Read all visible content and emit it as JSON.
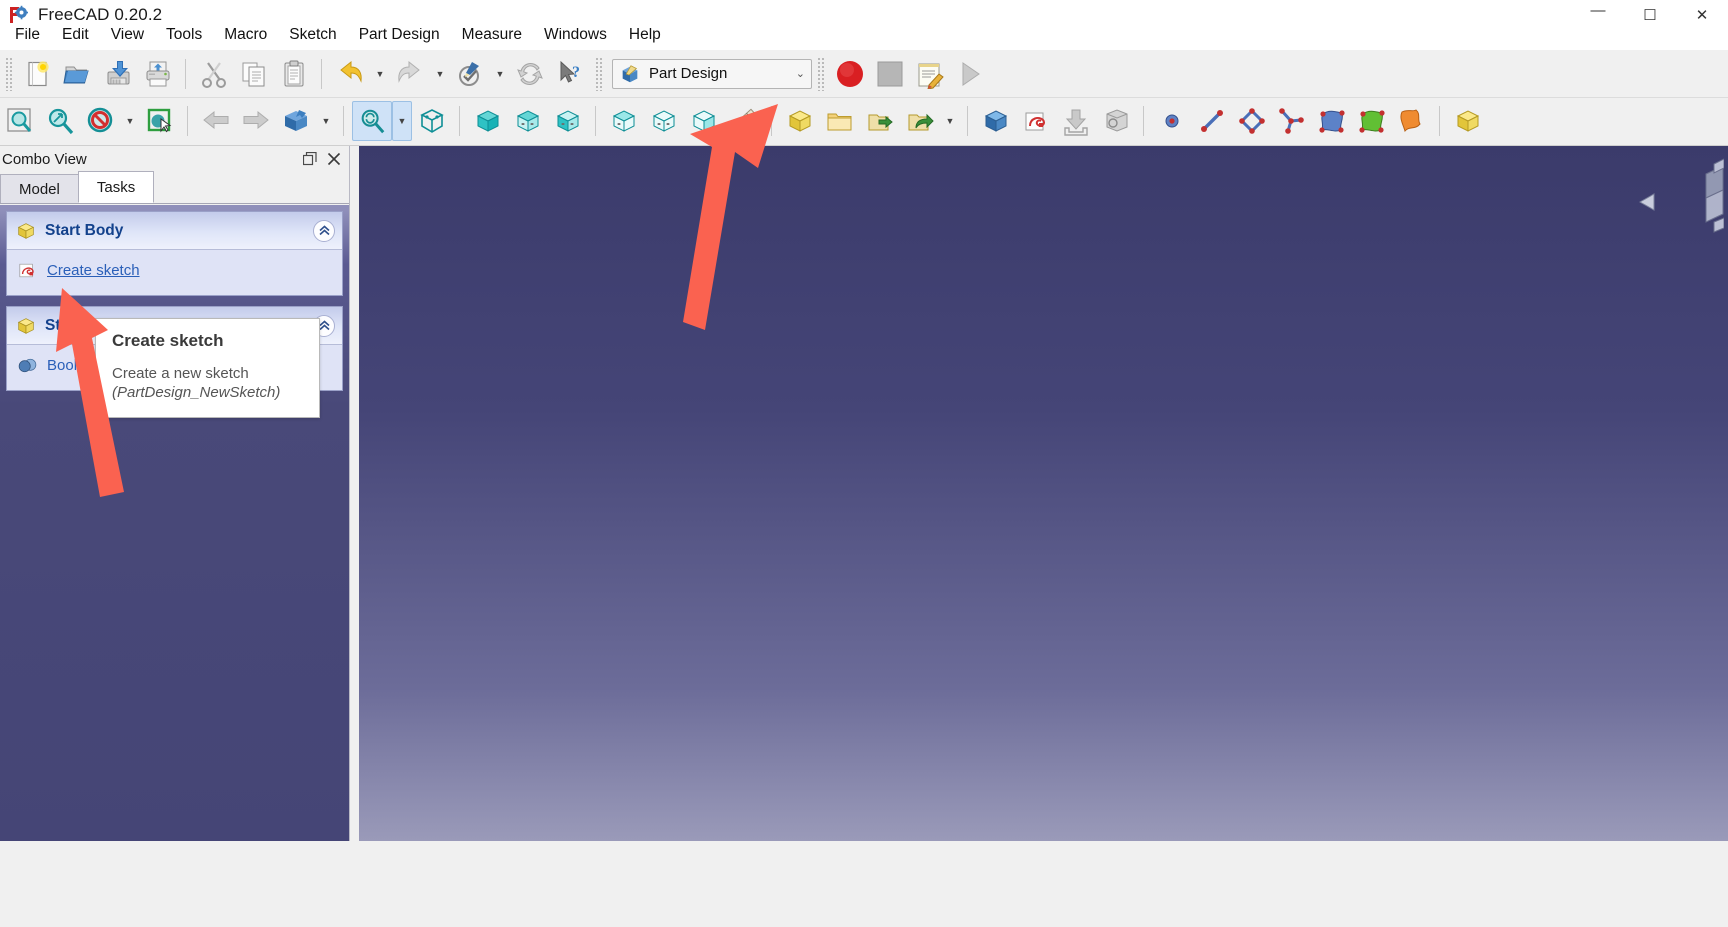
{
  "window": {
    "title": "FreeCAD 0.20.2",
    "app_icon": "freecad-logo-icon",
    "minimize_label": "—",
    "maximize_label": "☐",
    "close_label": "✕"
  },
  "menubar": {
    "items": [
      {
        "label": "File"
      },
      {
        "label": "Edit"
      },
      {
        "label": "View"
      },
      {
        "label": "Tools"
      },
      {
        "label": "Macro"
      },
      {
        "label": "Sketch"
      },
      {
        "label": "Part Design"
      },
      {
        "label": "Measure"
      },
      {
        "label": "Windows"
      },
      {
        "label": "Help"
      }
    ]
  },
  "toolbars": {
    "row1": [
      {
        "name": "new-document-button",
        "icon": "new-file-icon"
      },
      {
        "name": "open-document-button",
        "icon": "open-folder-icon"
      },
      {
        "name": "save-document-button",
        "icon": "save-disk-icon"
      },
      {
        "name": "print-button",
        "icon": "printer-icon"
      },
      {
        "name": "separator",
        "icon": "separator"
      },
      {
        "name": "cut-button",
        "icon": "scissors-icon"
      },
      {
        "name": "copy-button",
        "icon": "copy-icon"
      },
      {
        "name": "paste-button",
        "icon": "clipboard-paste-icon"
      },
      {
        "name": "separator",
        "icon": "separator"
      },
      {
        "name": "undo-button",
        "icon": "undo-arrow-icon"
      },
      {
        "name": "undo-dropdown",
        "icon": "chevron-down-icon"
      },
      {
        "name": "redo-button",
        "icon": "redo-arrow-icon"
      },
      {
        "name": "redo-dropdown",
        "icon": "chevron-down-icon"
      },
      {
        "name": "refine-shape-button",
        "icon": "check-pencil-icon"
      },
      {
        "name": "refine-dropdown",
        "icon": "chevron-down-icon"
      },
      {
        "name": "refresh-button",
        "icon": "refresh-icon"
      },
      {
        "name": "whats-this-button",
        "icon": "cursor-question-icon"
      },
      {
        "name": "grip",
        "icon": "grip"
      }
    ],
    "workbench": {
      "name": "workbench-selector",
      "value": "Part Design",
      "icon": "part-design-workbench-icon"
    },
    "macro_tools": [
      {
        "name": "macro-record-button",
        "icon": "record-circle-icon"
      },
      {
        "name": "macro-stop-button",
        "icon": "stop-square-icon"
      },
      {
        "name": "macro-edit-button",
        "icon": "notepad-pencil-icon"
      },
      {
        "name": "macro-execute-button",
        "icon": "play-triangle-icon"
      }
    ],
    "row2": [
      {
        "name": "fit-all-button",
        "icon": "fit-all-icon"
      },
      {
        "name": "fit-selection-button",
        "icon": "fit-selection-icon"
      },
      {
        "name": "draw-style-button",
        "icon": "no-entry-icon"
      },
      {
        "name": "draw-style-dropdown",
        "icon": "chevron-down-icon"
      },
      {
        "name": "selection-view-button",
        "icon": "select-box-icon"
      },
      {
        "name": "separator",
        "icon": "separator"
      },
      {
        "name": "previous-view-button",
        "icon": "arrow-left-icon"
      },
      {
        "name": "next-view-button",
        "icon": "arrow-right-icon"
      },
      {
        "name": "isometric-view-button",
        "icon": "axonometric-cube-icon"
      },
      {
        "name": "isometric-dropdown",
        "icon": "chevron-down-icon"
      },
      {
        "name": "separator",
        "icon": "separator"
      },
      {
        "name": "sync-view-button",
        "icon": "sync-view-icon"
      },
      {
        "name": "sync-view-dropdown",
        "icon": "chevron-down-icon"
      },
      {
        "name": "axonometric-button",
        "icon": "axonometric-icon"
      },
      {
        "name": "separator",
        "icon": "separator"
      },
      {
        "name": "front-view-button",
        "icon": "front-view-cube-icon"
      },
      {
        "name": "top-view-button",
        "icon": "top-view-cube-icon"
      },
      {
        "name": "right-view-button",
        "icon": "right-view-cube-icon"
      },
      {
        "name": "separator",
        "icon": "separator"
      },
      {
        "name": "rear-view-button",
        "icon": "rear-view-cube-icon"
      },
      {
        "name": "bottom-view-button",
        "icon": "bottom-view-cube-icon"
      },
      {
        "name": "left-view-button",
        "icon": "left-view-cube-icon"
      },
      {
        "name": "measure-button",
        "icon": "ruler-icon"
      },
      {
        "name": "separator",
        "icon": "separator"
      },
      {
        "name": "create-body-button",
        "icon": "yellow-body-icon"
      },
      {
        "name": "create-group-button",
        "icon": "folder-icon"
      },
      {
        "name": "create-part-button",
        "icon": "export-part-icon"
      },
      {
        "name": "make-link-button",
        "icon": "link-arrow-icon"
      },
      {
        "name": "link-dropdown",
        "icon": "chevron-down-icon"
      },
      {
        "name": "separator",
        "icon": "separator"
      },
      {
        "name": "part-box-button",
        "icon": "blue-box-icon"
      },
      {
        "name": "create-sketch-button",
        "icon": "create-sketch-icon"
      },
      {
        "name": "attach-sketch-button",
        "icon": "attach-down-icon"
      },
      {
        "name": "validate-sketch-button",
        "icon": "validate-sketch-icon"
      },
      {
        "name": "separator",
        "icon": "separator"
      },
      {
        "name": "create-point-button",
        "icon": "point-icon"
      },
      {
        "name": "create-line-button",
        "icon": "line-icon"
      },
      {
        "name": "create-polygon-button",
        "icon": "polygon-icon"
      },
      {
        "name": "create-polyline-button",
        "icon": "polyline-icon"
      },
      {
        "name": "create-bspline-surface-button",
        "icon": "blue-surface-icon"
      },
      {
        "name": "create-face-button",
        "icon": "green-face-icon"
      },
      {
        "name": "create-shape-button",
        "icon": "orange-shape-icon"
      },
      {
        "name": "separator",
        "icon": "separator"
      },
      {
        "name": "create-box-primitive-button",
        "icon": "yellow-box-icon"
      }
    ]
  },
  "combo_view": {
    "title": "Combo View",
    "float_button": "undock-icon",
    "close_button": "close-icon",
    "tabs": [
      {
        "label": "Model",
        "selected": false,
        "name": "tab-model"
      },
      {
        "label": "Tasks",
        "selected": true,
        "name": "tab-tasks"
      }
    ],
    "panels": [
      {
        "name": "start-body-panel",
        "title": "Start Body",
        "icon": "yellow-body-icon",
        "collapse_icon": "chevron-double-up-icon",
        "items": [
          {
            "label": "Create sketch",
            "icon": "create-sketch-icon",
            "name": "create-sketch-link"
          }
        ]
      },
      {
        "name": "start-part-panel",
        "title": "Start Part",
        "icon": "yellow-body-icon",
        "collapse_icon": "chevron-double-up-icon",
        "items": [
          {
            "label": "Boolean",
            "icon": "boolean-spheres-icon",
            "name": "boolean-link"
          }
        ]
      }
    ]
  },
  "tooltip": {
    "name": "create-sketch-tooltip",
    "title": "Create sketch",
    "description": "Create a new sketch",
    "command": "(PartDesign_NewSketch)"
  },
  "annotations": {
    "arrow_color": "#fa6250",
    "arrows": [
      {
        "name": "arrow-to-create-sketch"
      },
      {
        "name": "arrow-to-toolbar-icon"
      }
    ]
  },
  "view3d": {
    "name": "3d-viewport",
    "navigation_cube": "navigation-cube"
  }
}
